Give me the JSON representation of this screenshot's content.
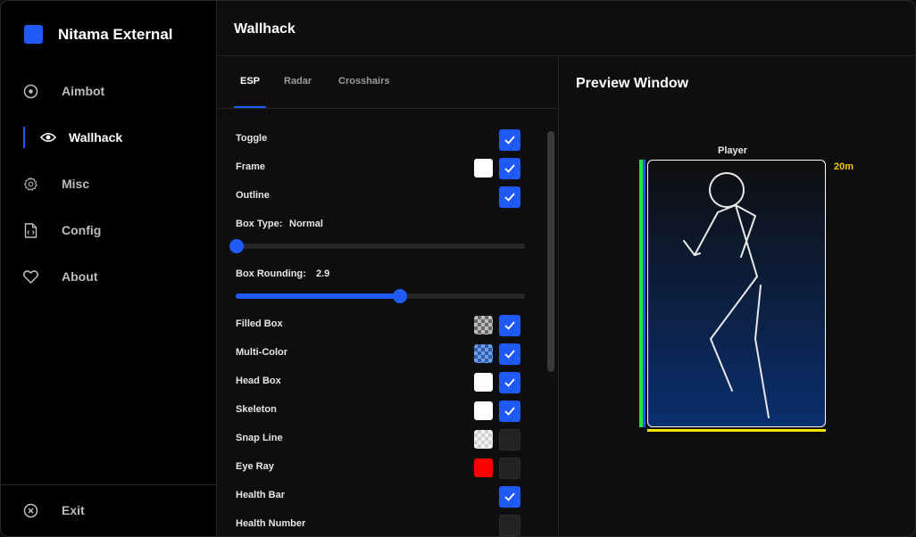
{
  "app": {
    "name": "Nitama External",
    "accent": "#2159f5"
  },
  "sidebar": {
    "items": [
      {
        "label": "Aimbot",
        "icon": "target-icon"
      },
      {
        "label": "Wallhack",
        "icon": "eye-icon",
        "active": true
      },
      {
        "label": "Misc",
        "icon": "gear-icon"
      },
      {
        "label": "Config",
        "icon": "file-code-icon"
      },
      {
        "label": "About",
        "icon": "heart-icon"
      }
    ],
    "exit_label": "Exit"
  },
  "header": {
    "title": "Wallhack"
  },
  "tabs": [
    {
      "label": "ESP",
      "active": true
    },
    {
      "label": "Radar"
    },
    {
      "label": "Crosshairs"
    }
  ],
  "esp": {
    "toggle": {
      "label": "Toggle",
      "checked": true
    },
    "frame": {
      "label": "Frame",
      "checked": true,
      "color": "#ffffff"
    },
    "outline": {
      "label": "Outline",
      "checked": true
    },
    "box_type": {
      "label": "Box Type:",
      "value": "Normal",
      "slider": 0.0
    },
    "box_rounding": {
      "label": "Box Rounding:",
      "value": "2.9",
      "slider": 0.57
    },
    "filled_box": {
      "label": "Filled Box",
      "checked": true,
      "swatch": "checker"
    },
    "multi_color": {
      "label": "Multi-Color",
      "checked": true,
      "swatch": "blue-checker"
    },
    "head_box": {
      "label": "Head Box",
      "checked": true,
      "color": "#ffffff"
    },
    "skeleton": {
      "label": "Skeleton",
      "checked": true,
      "color": "#ffffff"
    },
    "snap_line": {
      "label": "Snap Line",
      "checked": false,
      "swatch": "light-checker"
    },
    "eye_ray": {
      "label": "Eye Ray",
      "checked": false,
      "color": "#ff0000"
    },
    "health_bar": {
      "label": "Health Bar",
      "checked": true
    },
    "health_number": {
      "label": "Health Number",
      "checked": false
    }
  },
  "preview": {
    "title": "Preview Window",
    "player_label": "Player",
    "distance_label": "20m",
    "health_color": "#28e03a",
    "armor_color": "#2159f5",
    "snap_color": "#f5e400",
    "distance_color": "#f5c400"
  }
}
